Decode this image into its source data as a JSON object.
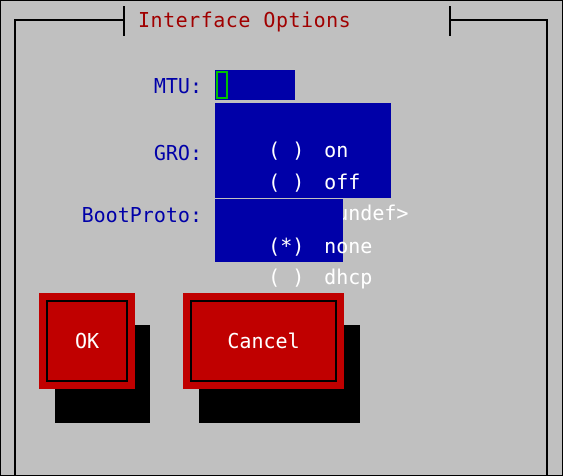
{
  "dialog": {
    "title": "Interface Options"
  },
  "fields": {
    "mtu_label": "MTU:",
    "mtu_value": "",
    "gro_label": "GRO:",
    "bootproto_label": "BootProto:"
  },
  "gro_options": [
    {
      "mark": "( )",
      "label": "on"
    },
    {
      "mark": "( )",
      "label": "off"
    },
    {
      "mark": "(*)",
      "label": "<undef>"
    }
  ],
  "bootproto_options": [
    {
      "mark": "(*)",
      "label": "none"
    },
    {
      "mark": "( )",
      "label": "dhcp"
    }
  ],
  "buttons": {
    "ok_label": "OK",
    "cancel_label": "Cancel"
  },
  "colors": {
    "background": "#c0c0c0",
    "field_blue": "#0000a8",
    "button_red": "#c00000",
    "title_red": "#a00000",
    "cursor_green": "#00c000"
  }
}
